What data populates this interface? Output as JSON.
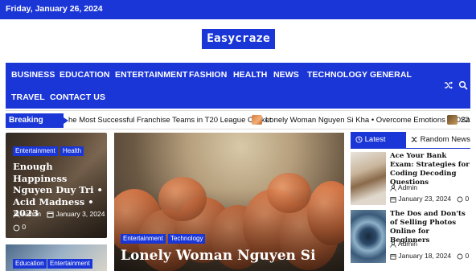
{
  "topbar": {
    "date": "Friday, January 26, 2024"
  },
  "site": {
    "logo": "Easycraze"
  },
  "nav": {
    "items": [
      "BUSINESS",
      "EDUCATION",
      "ENTERTAINMENT",
      "FASHION",
      "HEALTH",
      "NEWS",
      "TECHNOLOGY",
      "GENERAL",
      "TRAVEL",
      "CONTACT US"
    ],
    "shuffle_icon": "shuffle-icon",
    "search_icon": "search-icon"
  },
  "breaking": {
    "label": "Breaking News",
    "items": [
      "he Most Successful Franchise Teams in T20 League Cricket",
      "Lonely Woman Nguyen Si Kha • Overcome Emotions • 2022",
      "Savor"
    ]
  },
  "left_cards": [
    {
      "tags": [
        "Entertainment",
        "Health"
      ],
      "title": "Enough Happiness Nguyen Duy Tri • Acid Madness • 2023",
      "author": "Admin",
      "date": "January 3, 2024",
      "comments": "0"
    },
    {
      "tags": [
        "Education",
        "Entertainment"
      ]
    }
  ],
  "hero": {
    "tags": [
      "Entertainment",
      "Technology"
    ],
    "title": "Lonely Woman Nguyen Si"
  },
  "sidebar": {
    "tab_latest": "Latest News",
    "tab_random": "Random News",
    "posts": [
      {
        "title": "Ace Your Bank Exam: Strategies for Coding Decoding Questions",
        "author": "Admin",
        "date": "January 23, 2024",
        "comments": "0"
      },
      {
        "title": "The Dos and Don'ts of Selling Photos Online for Beginners",
        "author": "Admin",
        "date": "January 18, 2024",
        "comments": "0"
      }
    ]
  },
  "colors": {
    "accent": "#1b36d6",
    "text": "#1a1a1a",
    "white": "#ffffff"
  }
}
